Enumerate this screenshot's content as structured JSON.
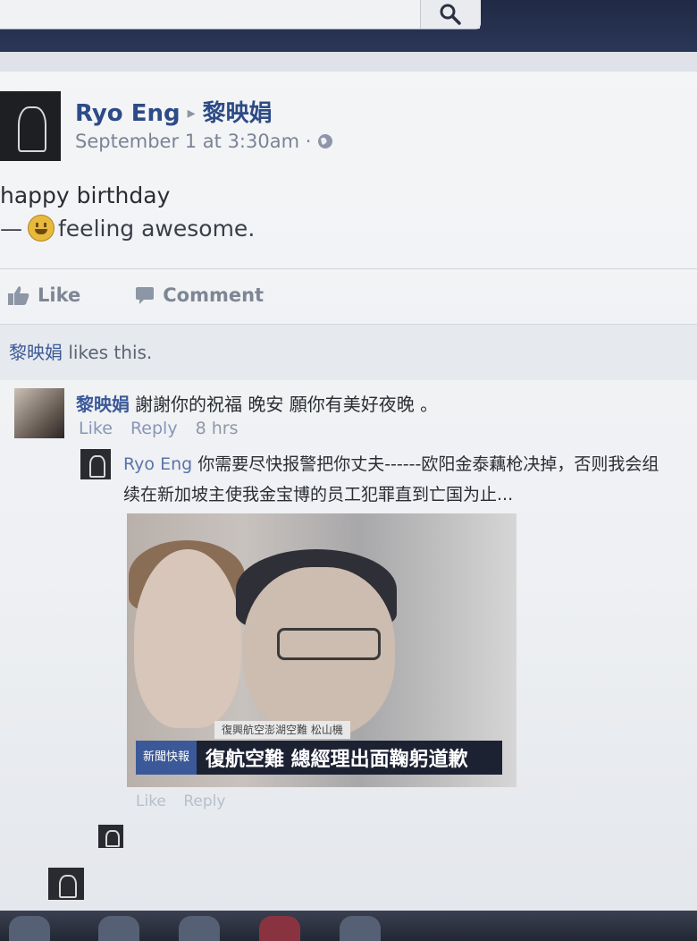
{
  "search": {
    "icon": "search-icon"
  },
  "post": {
    "author": "Ryo Eng",
    "separator": "▸",
    "recipient": "黎映娟",
    "time": "September 1 at 3:30am",
    "time_sep": "·",
    "text": "happy birthday",
    "feeling_dash": "—",
    "feeling": "feeling awesome."
  },
  "actions": {
    "like": "Like",
    "comment": "Comment"
  },
  "likes": {
    "name": "黎映娟",
    "suffix": "likes this."
  },
  "comments": [
    {
      "name": "黎映娟",
      "text": "謝謝你的祝福 晚安 願你有美好夜晚 。",
      "like": "Like",
      "reply": "Reply",
      "age": "8 hrs"
    },
    {
      "name": "Ryo Eng",
      "text": "你需要尽快报警把你丈夫------欧阳金泰藕枪决掉，否则我会组",
      "text_line2": "续在新加坡主使我金宝博的员工犯罪直到亡国为止...",
      "photo_caption_top": "復興航空澎湖空難 松山機",
      "photo_caption_tag": "新聞快報",
      "photo_caption_main": "復航空難 總經理出面鞠躬道歉",
      "like": "Like",
      "reply": "Reply"
    }
  ]
}
